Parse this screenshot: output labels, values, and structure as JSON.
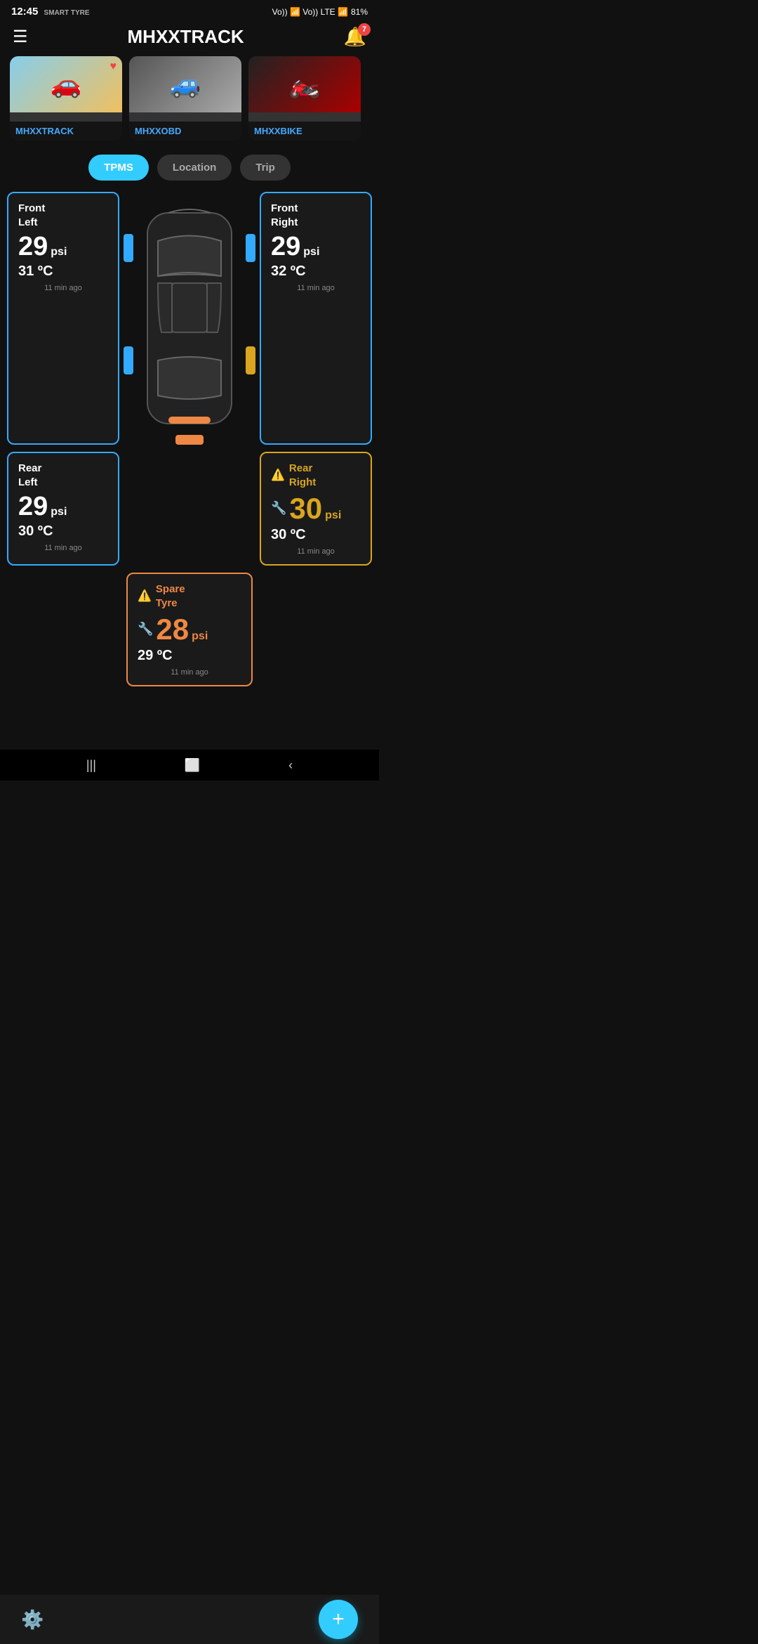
{
  "statusBar": {
    "time": "12:45",
    "smartTyre": "SMART TYRE",
    "signal": "Vo)) LTE1 | Vo)) LTE2",
    "battery": "81%"
  },
  "header": {
    "title": "MHXXTRACK",
    "notifCount": "7"
  },
  "vehicles": [
    {
      "name": "MHXXTRACK",
      "emoji": "🚗",
      "color": "#f5a623",
      "favorite": true
    },
    {
      "name": "MHXXOBD",
      "emoji": "🚙",
      "color": "#aaa",
      "favorite": false
    },
    {
      "name": "MHXXBIKE",
      "emoji": "🏍️",
      "color": "#e44",
      "favorite": false
    }
  ],
  "tabs": [
    {
      "id": "tpms",
      "label": "TPMS",
      "active": true
    },
    {
      "id": "location",
      "label": "Location",
      "active": false
    },
    {
      "id": "trip",
      "label": "Trip",
      "active": false
    }
  ],
  "tpms": {
    "frontLeft": {
      "label": "Front\nLeft",
      "psi": "29",
      "temp": "31 ºC",
      "time": "11 min ago",
      "status": "normal"
    },
    "frontRight": {
      "label": "Front\nRight",
      "psi": "29",
      "temp": "32 ºC",
      "time": "11 min ago",
      "status": "normal"
    },
    "rearLeft": {
      "label": "Rear\nLeft",
      "psi": "29",
      "temp": "30 ºC",
      "time": "11 min ago",
      "status": "normal"
    },
    "rearRight": {
      "label": "Rear\nRight",
      "psi": "30",
      "temp": "30 ºC",
      "time": "11 min ago",
      "status": "warn"
    },
    "spare": {
      "label": "Spare\nTyre",
      "psi": "28",
      "temp": "29 ºC",
      "time": "11 min ago",
      "status": "alert"
    }
  },
  "fab": {
    "label": "+"
  },
  "nav": {
    "back": "‹",
    "home": "⬜",
    "recent": "|||"
  }
}
